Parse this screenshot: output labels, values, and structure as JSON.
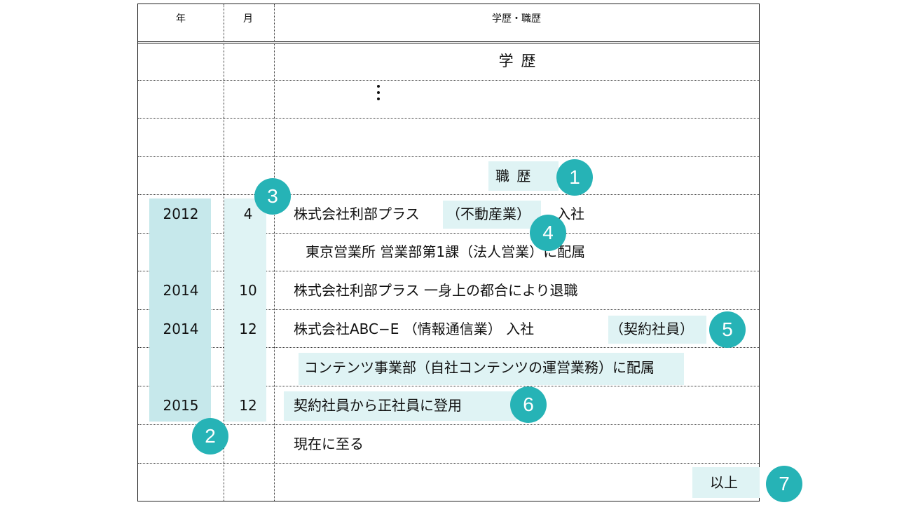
{
  "header": {
    "year": "年",
    "month": "月",
    "history": "学歴・職歴"
  },
  "section_education": "学 歴",
  "ellipsis_icon": "vertical-ellipsis-icon",
  "section_work": "職 歴",
  "rows": [
    {
      "year": "2012",
      "month": "4",
      "text_a": "株式会社利部プラス",
      "text_b": "（不動産業）",
      "text_c": "入社"
    },
    {
      "text": "東京営業所 営業部第1課（法人営業）に配属"
    },
    {
      "year": "2014",
      "month": "10",
      "text": "株式会社利部プラス 一身上の都合により退職"
    },
    {
      "year": "2014",
      "month": "12",
      "text_a": "株式会社ABC−E （情報通信業） 入社",
      "text_b": "（契約社員）"
    },
    {
      "text": "コンテンツ事業部（自社コンテンツの運営業務）に配属"
    },
    {
      "year": "2015",
      "month": "12",
      "text": "契約社員から正社員に登用"
    },
    {
      "text": "現在に至る"
    }
  ],
  "closing": "以上",
  "badges": [
    "1",
    "2",
    "3",
    "4",
    "5",
    "6",
    "7"
  ],
  "colors": {
    "badge": "#26b3b6",
    "highlight": "#dff3f4",
    "highlight_strong": "#c6e8eb"
  }
}
